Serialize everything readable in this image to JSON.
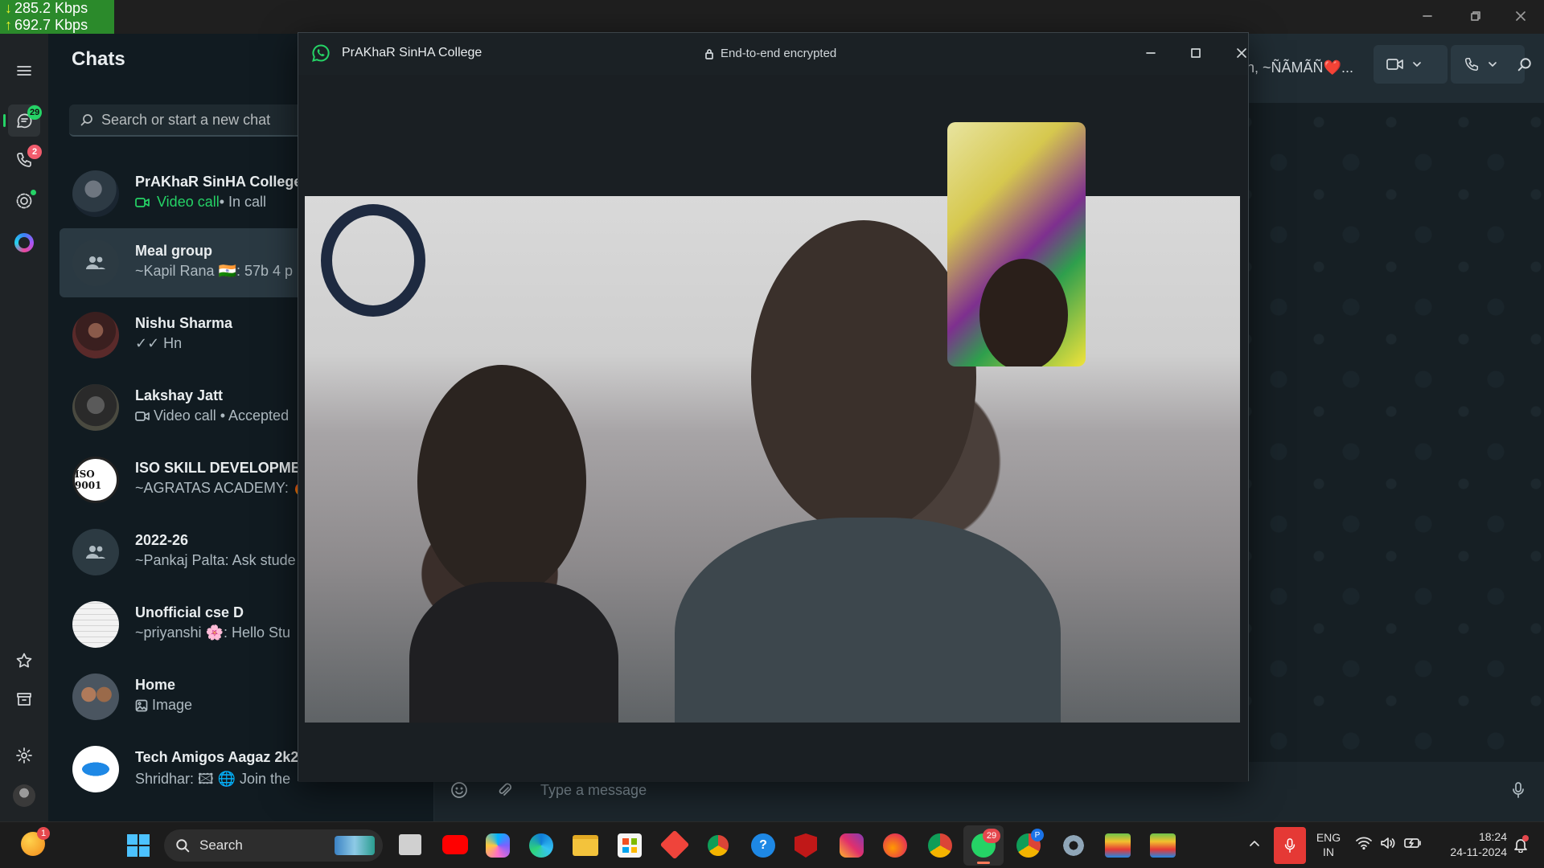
{
  "netspeed": {
    "download": "285.2 Kbps",
    "upload": "692.7 Kbps",
    "down_arrow": "↓",
    "up_arrow": "↑"
  },
  "rail": {
    "chats_badge": "29",
    "calls_badge": "2",
    "colors": {
      "chats_badge": "#25d366",
      "calls_badge": "#f15c6d"
    }
  },
  "chat_panel": {
    "title": "Chats",
    "search_placeholder": "Search or start a new chat",
    "items": [
      {
        "name": "PrAKhaR SinHA College",
        "preview_call": "Video call",
        "preview_rest": " • In call"
      },
      {
        "name": "Meal group",
        "preview": "~Kapil Rana 🇮🇳: 57b 4 p"
      },
      {
        "name": "Nishu Sharma",
        "preview": "✓✓ Hn"
      },
      {
        "name": "Lakshay Jatt",
        "preview": "Video call • Accepted"
      },
      {
        "name": "ISO SKILL DEVELOPMEN",
        "preview": "~AGRATAS ACADEMY: 🔥"
      },
      {
        "name": "2022-26",
        "preview": "~Pankaj Palta: Ask stude"
      },
      {
        "name": "Unofficial cse D",
        "preview": "~priyanshi 🌸: Hello  Stu"
      },
      {
        "name": "Home",
        "preview": "Image"
      },
      {
        "name": "Tech Amigos Aagaz 2k2",
        "preview": "Shridhar: 🖾 🌐 Join the"
      }
    ],
    "iso_avatar_text": "ISO 9001"
  },
  "conversation": {
    "members": "an, ~ÑÃMÃÑ❤️...",
    "composer_placeholder": "Type a message"
  },
  "call_window": {
    "title": "PrAKhaR SinHA College",
    "encryption": "End-to-end encrypted"
  },
  "taskbar": {
    "search_placeholder": "Search",
    "lang": "ENG",
    "region": "IN",
    "time": "18:24",
    "date": "24-11-2024",
    "notification_badge": "1",
    "whatsapp_badge": "29",
    "chrome_profile_p": "P"
  }
}
